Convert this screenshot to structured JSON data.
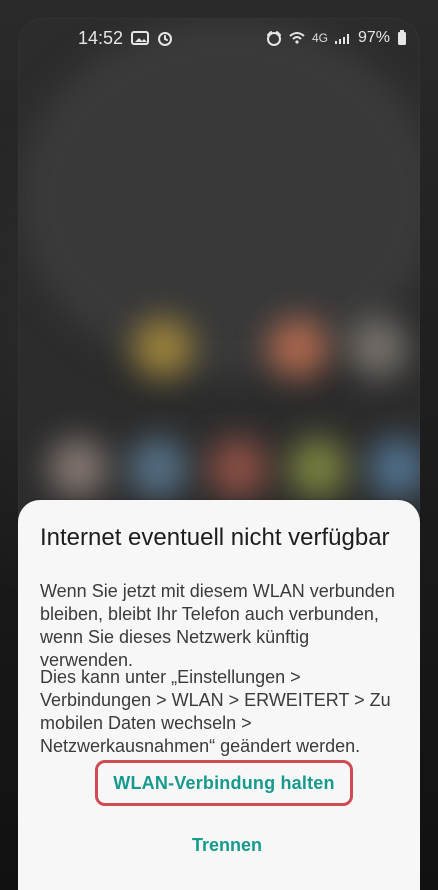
{
  "status_bar": {
    "time": "14:52",
    "battery": "97%",
    "network": "4G"
  },
  "dialog": {
    "title": "Internet eventuell nicht verfügbar",
    "body_1": "Wenn Sie jetzt mit diesem WLAN verbunden bleiben, bleibt Ihr Telefon auch verbunden, wenn Sie dieses Netzwerk künftig verwenden.",
    "body_2": "Dies kann unter „Einstellungen > Verbindungen > WLAN > ERWEITERT > Zu mobilen Daten wechseln > Netzwerkausnahmen“ geändert werden.",
    "primary_action": "WLAN-Verbindung halten",
    "secondary_action": "Trennen"
  },
  "colors": {
    "accent": "#159a8d",
    "highlight_border": "#cf4a54",
    "sheet_bg": "#f7f7f7"
  },
  "icons": {
    "gallery": "image-icon",
    "clock": "alarm-icon",
    "wifi": "wifi-icon",
    "signal": "signal-icon",
    "battery": "battery-icon"
  }
}
